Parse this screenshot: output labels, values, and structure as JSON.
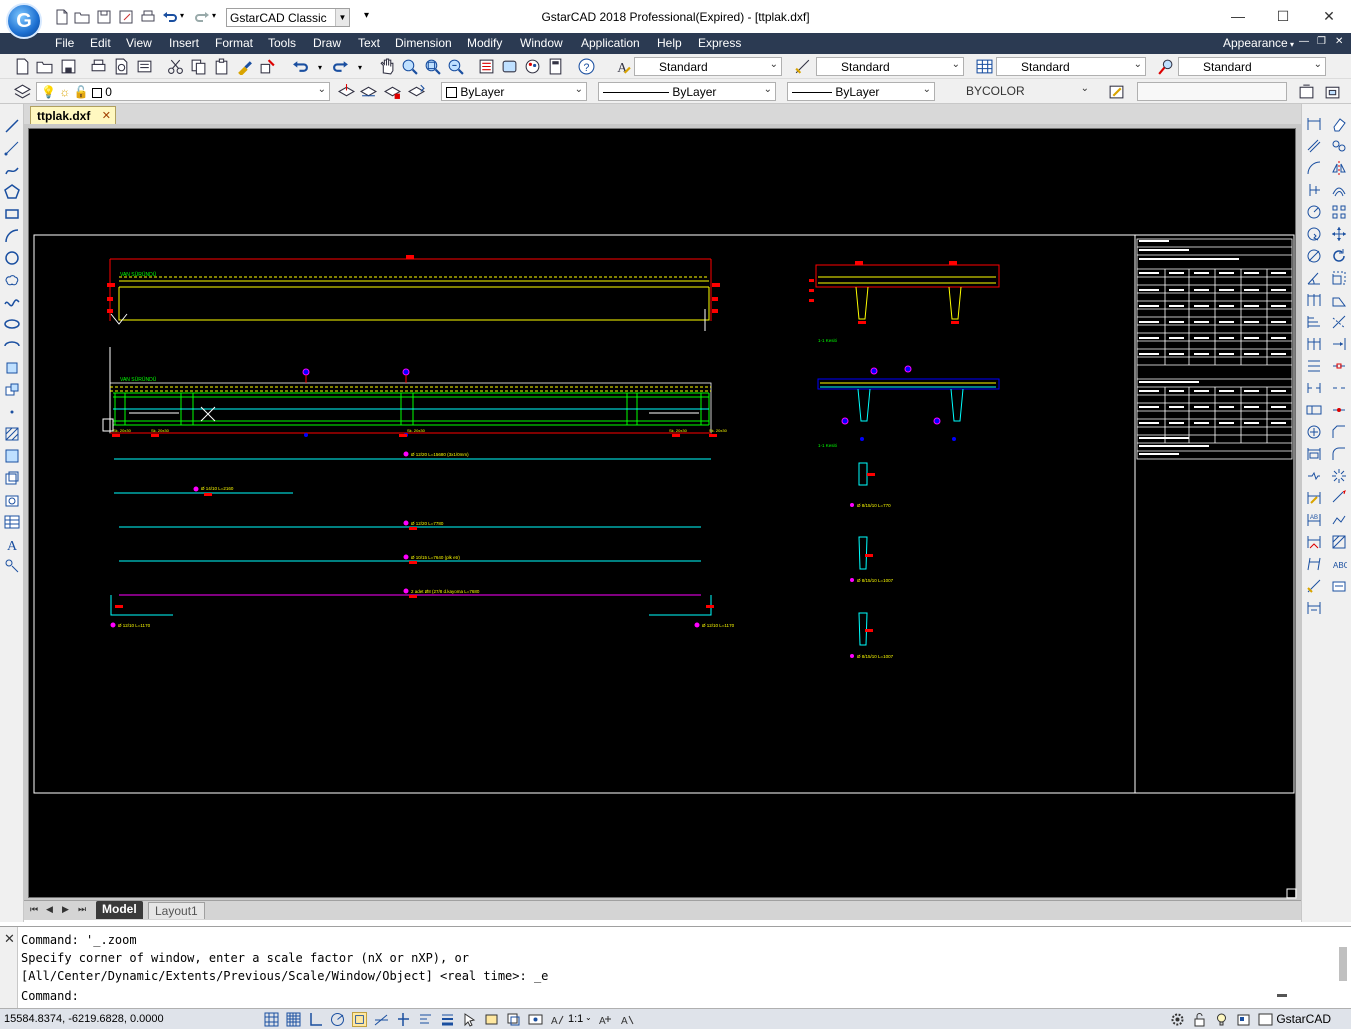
{
  "titlebar": {
    "workspace": "GstarCAD Classic",
    "title": "GstarCAD 2018 Professional(Expired) - [ttplak.dxf]",
    "logo": "G"
  },
  "menu": {
    "items": [
      "File",
      "Edit",
      "View",
      "Insert",
      "Format",
      "Tools",
      "Draw",
      "Text",
      "Dimension",
      "Modify",
      "Window",
      "Application",
      "Help",
      "Express"
    ],
    "appearance": "Appearance"
  },
  "toolbar1": {
    "text_style": "Standard",
    "dim_style": "Standard",
    "table_style": "Standard",
    "mleader_style": "Standard"
  },
  "toolbar2": {
    "layer": "0",
    "color": "ByLayer",
    "linetype": "ByLayer",
    "lineweight": "ByLayer",
    "plotstyle": "BYCOLOR"
  },
  "document": {
    "tab": "ttplak.dxf",
    "close": "✕"
  },
  "drawing": {
    "label_top": "VAN SÜRÜNDÜ",
    "label_mid": "VAN SÜRÜNDÜ",
    "section_a": "1-1 Kesiti",
    "section_b": "1-1 Kesiti",
    "bar1": "Ø 12/20 L=15680 (3x1/0mm)",
    "bar2": "Ø 14/10 L=2160",
    "bar3": "Ø 12/20 L=7780",
    "bar4": "Ø 10/15 L=7640 (plk etr)",
    "bar5": "2 adet Ø8 (27/8 d.kayoma L=7680",
    "bar6a": "Ø 12/10 L=1170",
    "bar6b": "Ø 12/10 L=1170",
    "det1": "Ø 8/15/10 L=770",
    "det2": "Ø 8/15/10 L=1007",
    "det3": "Ø 8/15/10 L=1007",
    "bottom_a": "Sk. 20x30",
    "bottom_b": "Sk. 20x30",
    "bottom_c": "Sk. 20x30",
    "bottom_d": "Sk. 20x30",
    "bottom_e": "Sk. 20x30"
  },
  "layout_tabs": {
    "model": "Model",
    "layout1": "Layout1"
  },
  "command": {
    "line1": "Command: '_.zoom",
    "line2": "Specify corner of window, enter a scale factor (nX or nXP), or",
    "line3": "[All/Center/Dynamic/Extents/Previous/Scale/Window/Object] <real time>: _e",
    "prompt": "Command:"
  },
  "status": {
    "coords": "15584.8374, -6219.6828, 0.0000",
    "scale": "1:1",
    "brand": "GstarCAD"
  },
  "colors": {
    "menubar": "#2b3a52",
    "canvas": "#000000",
    "red": "#ff0000",
    "yellow": "#ffff00",
    "green": "#00ff00",
    "cyan": "#00ffff",
    "magenta": "#ff00ff",
    "blue": "#0000ff"
  }
}
